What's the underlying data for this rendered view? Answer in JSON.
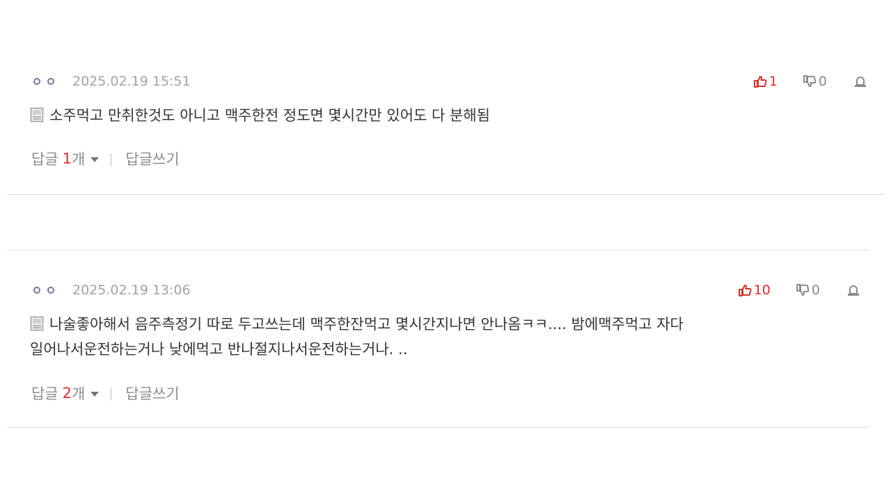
{
  "comments": [
    {
      "author_mask": "ㅇ ㅇ",
      "date": "2025.02.19 15:51",
      "up_count": "1",
      "down_count": "0",
      "text": "소주먹고 만취한것도 아니고 맥주한전 정도면 몇시간만 있어도 다 분해됨",
      "reply_label": "답글",
      "reply_count": "1",
      "reply_unit": "개",
      "write_reply": "답글쓰기"
    },
    {
      "author_mask": "ㅇ ㅇ",
      "date": "2025.02.19 13:06",
      "up_count": "10",
      "down_count": "0",
      "text_line1": "나술좋아해서 음주측정기 따로 두고쓰는데 맥주한잔먹고 몇시간지나면 안나옴ㅋㅋ.... 밤에맥주먹고 자다",
      "text_line2": "일어나서운전하는거나 낮에먹고 반나절지나서운전하는거나. ..",
      "reply_label": "답글",
      "reply_count": "2",
      "reply_unit": "개",
      "write_reply": "답글쓰기"
    }
  ],
  "icons": {
    "author": "user-mask-icon",
    "memo": "memo-icon",
    "upvote": "thumbs-up-icon",
    "downvote": "thumbs-down-icon",
    "report": "report-siren-icon",
    "expand": "caret-down-icon"
  },
  "colors": {
    "accent_red": "#d9302c",
    "meta_gray": "#a2a2a2",
    "text": "#333333",
    "divider": "#dddddd"
  }
}
